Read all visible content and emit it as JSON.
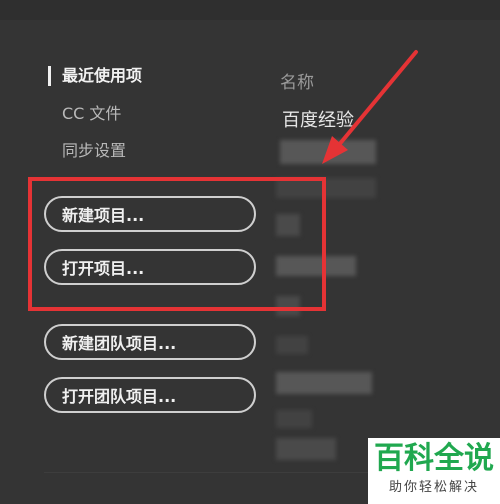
{
  "sidebar": {
    "items": [
      {
        "label": "最近使用项",
        "active": true
      },
      {
        "label": "CC 文件",
        "active": false
      },
      {
        "label": "同步设置",
        "active": false
      }
    ]
  },
  "file_list": {
    "column_header": "名称",
    "rows": [
      {
        "name": "百度经验"
      }
    ]
  },
  "actions": {
    "new_project": "新建项目...",
    "open_project": "打开项目...",
    "new_team_project": "新建团队项目...",
    "open_team_project": "打开团队项目..."
  },
  "annotation": {
    "highlight_color": "#e53335"
  },
  "watermark": {
    "title": "百科全说",
    "subtitle": "助你轻松解决",
    "color": "#20a84f"
  },
  "colors": {
    "background": "#343434",
    "text_primary": "#f0f0f0",
    "text_secondary": "#b9b9b9"
  }
}
